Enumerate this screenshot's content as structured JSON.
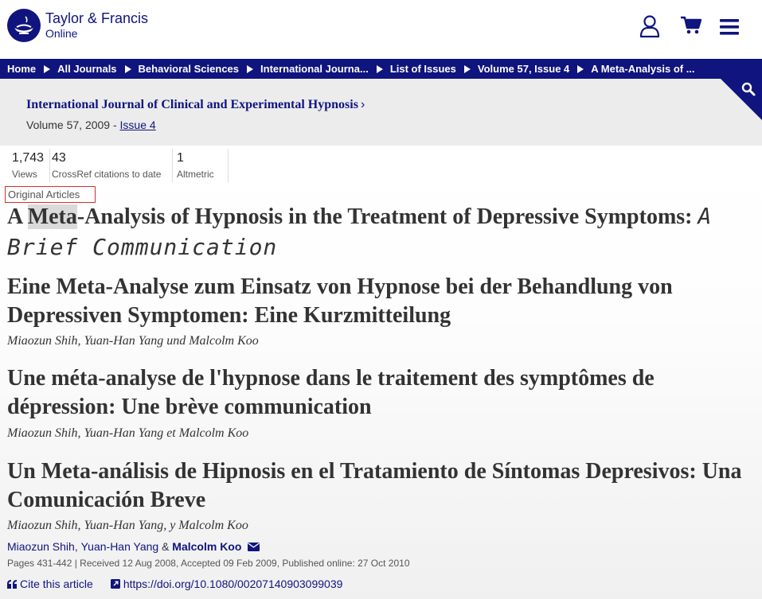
{
  "brand": {
    "name": "Taylor & Francis",
    "sub": "Online"
  },
  "breadcrumb": [
    "Home",
    "All Journals",
    "Behavioral Sciences",
    "International Journa...",
    "List of Issues",
    "Volume 57, Issue 4",
    "A Meta-Analysis of ..."
  ],
  "journal": {
    "title": "International Journal of Clinical and Experimental Hypnosis",
    "volume_prefix": "Volume 57, 2009 - ",
    "issue_link": "Issue 4"
  },
  "metrics": [
    {
      "value": "1,743",
      "label": "Views"
    },
    {
      "value": "43",
      "label": "CrossRef citations to date"
    },
    {
      "value": "1",
      "label": "Altmetric"
    }
  ],
  "article": {
    "section": "Original Articles",
    "title_before": "A ",
    "title_highlight": "Meta",
    "title_after": "-Analysis of Hypnosis in the Treatment of Depressive Symptoms: ",
    "subtitle": "A Brief Communication",
    "translations": [
      {
        "title": "Eine Meta-Analyse zum Einsatz von Hypnose bei der Behandlung von Depressiven Symptomen: Eine Kurzmitteilung",
        "authors": "Miaozun Shih, Yuan-Han Yang und Malcolm Koo"
      },
      {
        "title": "Une méta-analyse de l'hypnose dans le traitement des symptômes de dépression: Une brève communication",
        "authors": "Miaozun Shih, Yuan-Han Yang et Malcolm Koo"
      },
      {
        "title": "Un Meta-análisis de Hipnosis en el Tratamiento de Síntomas Depresivos: Una Comunicación Breve",
        "authors": "Miaozun Shih, Yuan-Han Yang, y Malcolm Koo"
      }
    ],
    "authors": [
      "Miaozun Shih",
      "Yuan-Han Yang",
      "Malcolm Koo"
    ],
    "author_sep": ",",
    "author_and": "&",
    "pub_info": "Pages 431-442 | Received 12 Aug 2008, Accepted 09 Feb 2009, Published online: 27 Oct 2010",
    "cite_label": "Cite this article",
    "doi": "https://doi.org/10.1080/00207140903099039"
  },
  "colors": {
    "brand": "#10147e",
    "highlight": "#dadada",
    "section_border": "#d32f2f"
  },
  "icons": [
    "user-icon",
    "cart-icon",
    "menu-icon",
    "search-icon",
    "envelope-icon",
    "quote-icon",
    "external-link-icon"
  ]
}
